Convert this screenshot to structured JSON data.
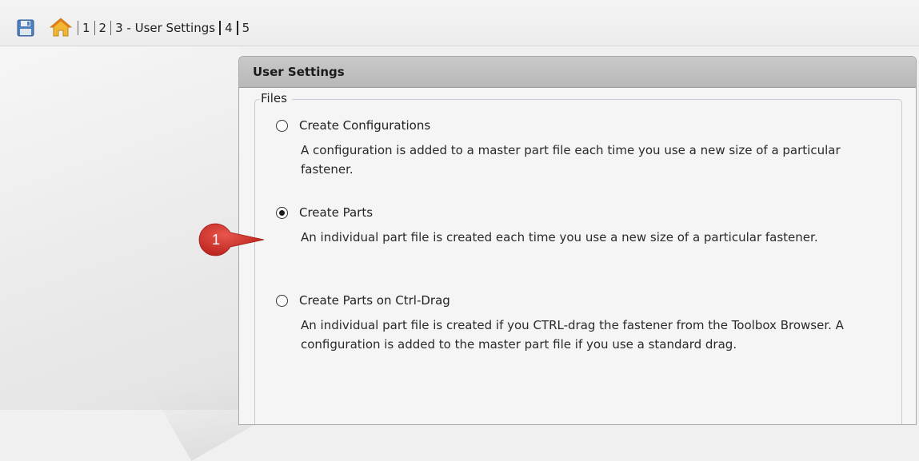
{
  "toolbar": {
    "save_icon": "save-disk-icon",
    "home_icon": "home-icon",
    "crumbs": [
      "1",
      "2",
      "3 - User Settings",
      "4",
      "5"
    ]
  },
  "panel": {
    "title": "User Settings",
    "group_label": "Files",
    "options": [
      {
        "label": "Create Configurations",
        "checked": false,
        "description": "A configuration is added to a master part file each time you use a new size of a particular fastener."
      },
      {
        "label": "Create Parts",
        "checked": true,
        "description": "An individual part file is created each time you use a new size of a particular fastener."
      },
      {
        "label": "Create Parts on Ctrl-Drag",
        "checked": false,
        "description": "An individual part file is created if you CTRL-drag the fastener from the Toolbox Browser. A configuration is added to the master part file if you use a standard drag."
      }
    ]
  },
  "callout": {
    "number": "1",
    "color": "#d5322a"
  }
}
